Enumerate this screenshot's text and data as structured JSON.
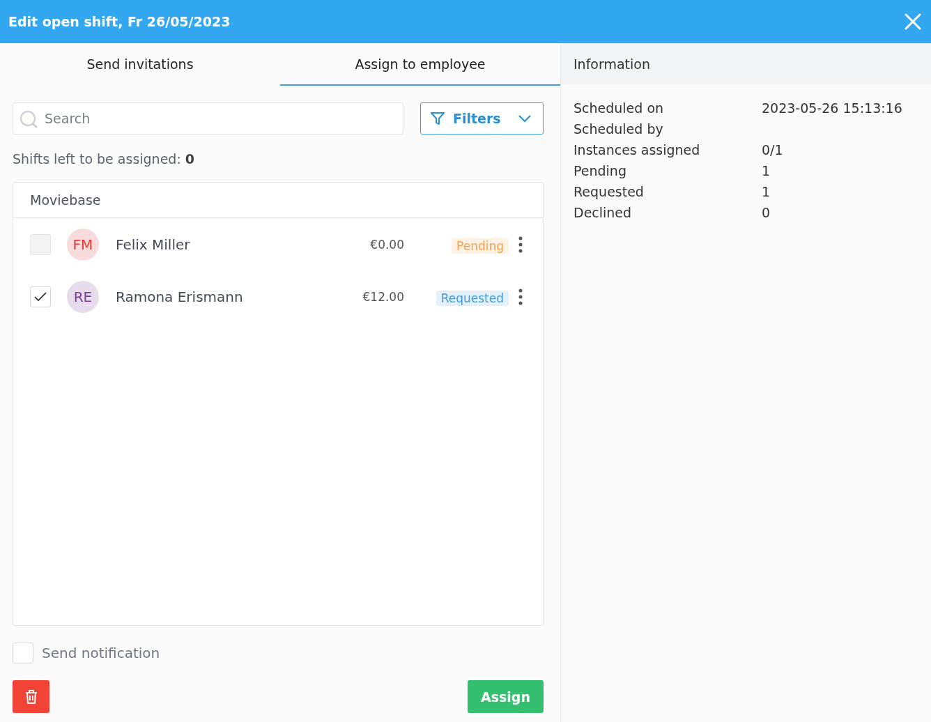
{
  "window": {
    "title": "Edit open shift, Fr 26/05/2023"
  },
  "tabs": [
    {
      "label": "Send invitations",
      "selected": false
    },
    {
      "label": "Assign to employee",
      "selected": true
    }
  ],
  "search": {
    "placeholder": "Search"
  },
  "filters_button": {
    "label": "Filters"
  },
  "shifts_left": {
    "label": "Shifts left to be assigned:",
    "value": "0"
  },
  "group": {
    "title": "Moviebase",
    "employees": [
      {
        "initials": "FM",
        "color": "#e53935",
        "name": "Felix Miller",
        "checked": false,
        "disabled": true,
        "amount": "€0.00",
        "status": {
          "label": "Pending",
          "color": "#f5a04a"
        }
      },
      {
        "initials": "RE",
        "color": "#7b3f98",
        "name": "Ramona Erismann",
        "checked": true,
        "disabled": false,
        "amount": "€12.00",
        "status": {
          "label": "Requested",
          "color": "#3d9de0"
        }
      }
    ]
  },
  "send_notification": {
    "label": "Send notification",
    "checked": false
  },
  "assign_button": {
    "label": "Assign"
  },
  "information": {
    "title": "Information",
    "rows": [
      {
        "label": "Scheduled on",
        "value": "2023-05-26 15:13:16"
      },
      {
        "label": "Scheduled by"
      },
      {
        "label": "Instances assigned",
        "value": "0/1"
      },
      {
        "label": "Pending",
        "value": "1"
      },
      {
        "label": "Requested",
        "value": "1"
      },
      {
        "label": "Declined",
        "value": "0"
      }
    ]
  }
}
